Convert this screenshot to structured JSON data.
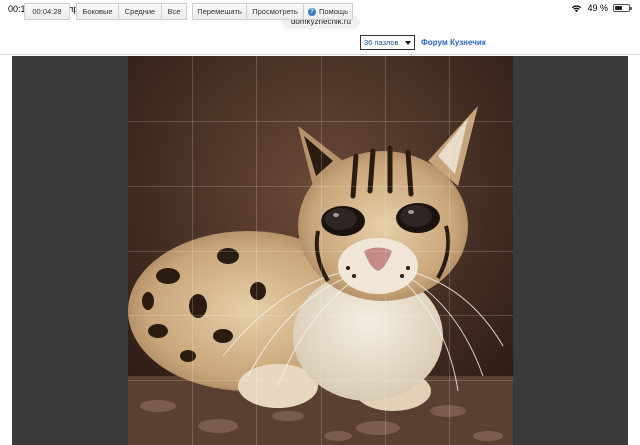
{
  "status_bar": {
    "time": "00:10",
    "date": "Вт 28 апр.",
    "battery_percent": "49 %",
    "battery_level": 0.49
  },
  "url": "domkyznechik.ru",
  "toolbar": {
    "timer": "00:04:28",
    "edge_label": "Боковые",
    "middle_label": "Средние",
    "all_label": "Все",
    "shuffle_label": "Перемешать",
    "preview_label": "Просмотреть",
    "help_label": "Помощь",
    "pieces_select": "36 пазлов",
    "forum_link": "Форум Кузнечик"
  },
  "puzzle": {
    "rows": 6,
    "cols": 6,
    "image_subject": "margay-cat-photo"
  }
}
